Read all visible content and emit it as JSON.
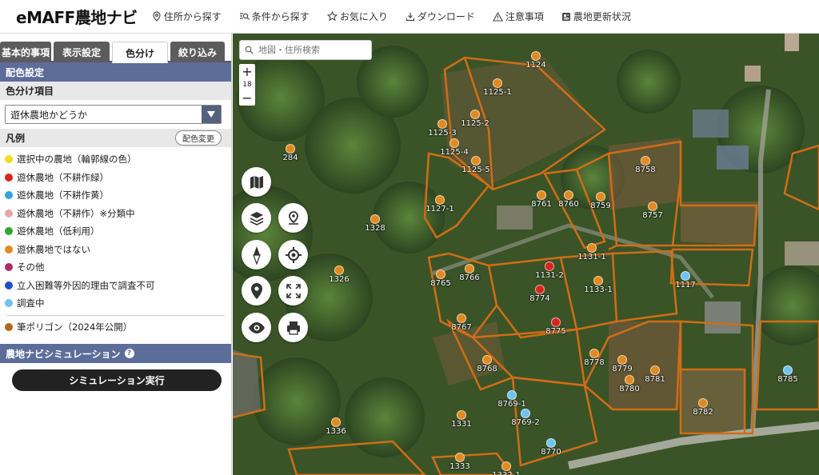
{
  "app": {
    "title": "eMAFF農地ナビ"
  },
  "nav": [
    {
      "label": "住所から探す",
      "icon": "location-pin-icon"
    },
    {
      "label": "条件から探す",
      "icon": "filter-search-icon"
    },
    {
      "label": "お気に入り",
      "icon": "star-icon"
    },
    {
      "label": "ダウンロード",
      "icon": "download-icon"
    },
    {
      "label": "注意事項",
      "icon": "warning-icon"
    },
    {
      "label": "農地更新状況",
      "icon": "news-icon"
    }
  ],
  "tabs": [
    {
      "label": "基本的事項",
      "active": false
    },
    {
      "label": "表示設定",
      "active": false
    },
    {
      "label": "色分け",
      "active": true
    },
    {
      "label": "絞り込み",
      "active": false
    }
  ],
  "color_settings": {
    "section_title": "配色設定",
    "item_title": "色分け項目",
    "selected_value": "遊休農地かどうか",
    "legend_title": "凡例",
    "change_button": "配色変更"
  },
  "legend": [
    {
      "label": "選択中の農地（輪郭線の色）",
      "color": "#f3dc1c"
    },
    {
      "label": "遊休農地（不耕作緑）",
      "color": "#d3261c"
    },
    {
      "label": "遊休農地（不耕作黄）",
      "color": "#37a0e0"
    },
    {
      "label": "遊休農地（不耕作）※分類中",
      "color": "#e6a7a7"
    },
    {
      "label": "遊休農地（低利用）",
      "color": "#2fa82e"
    },
    {
      "label": "遊休農地ではない",
      "color": "#e08a22"
    },
    {
      "label": "その他",
      "color": "#b02a6b"
    },
    {
      "label": "立入困難等外因的理由で調査不可",
      "color": "#1f4fd1"
    },
    {
      "label": "調査中",
      "color": "#6fc3f0"
    }
  ],
  "polygon_legend": {
    "label": "筆ポリゴン（2024年公開）",
    "color": "#b5651d"
  },
  "simulation": {
    "title": "農地ナビシミュレーション",
    "help_icon": "help-icon",
    "button": "シミュレーション実行"
  },
  "map": {
    "search_placeholder": "地図・住所検索",
    "zoom_in": "+",
    "zoom_level": "18",
    "zoom_out": "−",
    "controls": [
      "map-icon",
      "layers-icon",
      "route-pin-icon",
      "compass-icon",
      "gps-target-icon",
      "marker-icon",
      "fullscreen-icon",
      "eye-icon",
      "print-icon"
    ],
    "parcels": [
      {
        "label": "1124",
        "status": "not-idle"
      },
      {
        "label": "1125-1",
        "status": "not-idle"
      },
      {
        "label": "1125-2",
        "status": "not-idle"
      },
      {
        "label": "1125-3",
        "status": "not-idle"
      },
      {
        "label": "1125-4",
        "status": "not-idle"
      },
      {
        "label": "1125-5",
        "status": "not-idle"
      },
      {
        "label": "284",
        "status": "not-idle"
      },
      {
        "label": "1127-1",
        "status": "not-idle"
      },
      {
        "label": "1328",
        "status": "not-idle"
      },
      {
        "label": "8761",
        "status": "not-idle"
      },
      {
        "label": "8760",
        "status": "not-idle"
      },
      {
        "label": "8759",
        "status": "not-idle"
      },
      {
        "label": "8758",
        "status": "not-idle"
      },
      {
        "label": "8757",
        "status": "not-idle"
      },
      {
        "label": "1131-1",
        "status": "not-idle"
      },
      {
        "label": "1131-2",
        "status": "idle-red"
      },
      {
        "label": "1133-1",
        "status": "not-idle"
      },
      {
        "label": "1117",
        "status": "investigating"
      },
      {
        "label": "1326",
        "status": "not-idle"
      },
      {
        "label": "8765",
        "status": "not-idle"
      },
      {
        "label": "8766",
        "status": "not-idle"
      },
      {
        "label": "8774",
        "status": "idle-red"
      },
      {
        "label": "8775",
        "status": "idle-red"
      },
      {
        "label": "8767",
        "status": "not-idle"
      },
      {
        "label": "8768",
        "status": "not-idle"
      },
      {
        "label": "8778",
        "status": "not-idle"
      },
      {
        "label": "8779",
        "status": "not-idle"
      },
      {
        "label": "8780",
        "status": "not-idle"
      },
      {
        "label": "8781",
        "status": "not-idle"
      },
      {
        "label": "8785",
        "status": "investigating"
      },
      {
        "label": "8769-1",
        "status": "investigating"
      },
      {
        "label": "8769-2",
        "status": "investigating"
      },
      {
        "label": "8782",
        "status": "not-idle"
      },
      {
        "label": "1331",
        "status": "not-idle"
      },
      {
        "label": "1336",
        "status": "not-idle"
      },
      {
        "label": "8770",
        "status": "investigating"
      },
      {
        "label": "1333",
        "status": "not-idle"
      },
      {
        "label": "1332-1",
        "status": "not-idle"
      }
    ]
  }
}
